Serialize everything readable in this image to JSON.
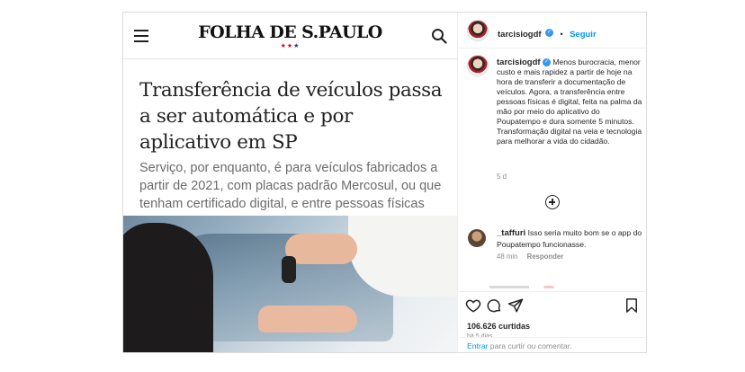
{
  "article": {
    "masthead": "FOLHA DE S.PAULO",
    "stars": "★★★",
    "headline": "Transferência de veículos passa a ser automática e por aplicativo em SP",
    "subhead": "Serviço, por enquanto, é para veículos fabricados a partir de 2021, com placas padrão Mercosul, ou que tenham certificado digital, e entre pessoas físicas"
  },
  "post": {
    "username": "tarcisiogdf",
    "follow_label": "Seguir",
    "caption": "Menos burocracia, menor custo e mais rapidez a partir de hoje na hora de transferir a documentação de veículos. Agora, a transferência entre pessoas físicas é digital, feita na palma da mão por meio do aplicativo do Poupatempo e dura somente 5 minutos. Transformação digital na veia e tecnologia para melhorar a vida do cidadão.",
    "caption_time": "5 d",
    "comment": {
      "username": "_taffuri",
      "text": "Isso seria muito bom se o app do Poupatempo funcionasse.",
      "time": "48 min",
      "reply_label": "Responder"
    },
    "likes": "106.626 curtidas",
    "posted_ago": "há 5 dias",
    "login_link": "Entrar",
    "login_text": " para curtir ou comentar."
  },
  "colors": {
    "link_blue": "#0095f6",
    "verified_blue": "#3897f0",
    "star_red": "#c8102e",
    "star_blue": "#1f3d7a"
  },
  "icons": [
    "menu-icon",
    "search-icon",
    "verified-icon",
    "plus-circle-icon",
    "heart-icon",
    "comment-icon",
    "share-icon",
    "bookmark-icon"
  ]
}
